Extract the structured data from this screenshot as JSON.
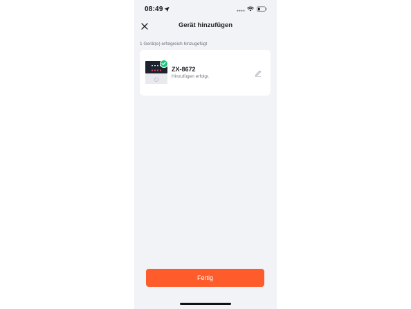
{
  "status_bar": {
    "time": "08:49",
    "icons": [
      "location-arrow-icon",
      "cellular-signal-icon",
      "wifi-icon",
      "battery-icon"
    ]
  },
  "header": {
    "title": "Gerät hinzufügen",
    "close_icon": "close-icon"
  },
  "main": {
    "section_label": "1 Gerät(e) erfolgreich hinzugefügt",
    "devices": [
      {
        "name": "ZX-8672",
        "status": "Hinzufügen erfolgr.",
        "badge_icon": "check-icon",
        "edit_icon": "pencil-icon"
      }
    ]
  },
  "footer": {
    "done_label": "Fertig"
  },
  "colors": {
    "accent": "#ff5c2b",
    "success": "#1ec47a",
    "background": "#f2f3f7",
    "card": "#ffffff"
  }
}
